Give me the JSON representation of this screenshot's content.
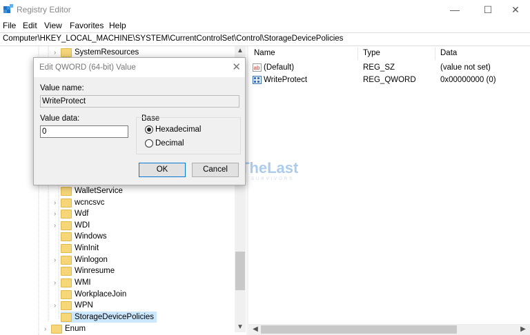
{
  "window": {
    "title": "Registry Editor",
    "controls": {
      "minimize": "—",
      "maximize": "☐",
      "close": "✕"
    }
  },
  "menu": [
    "File",
    "Edit",
    "View",
    "Favorites",
    "Help"
  ],
  "address": "Computer\\HKEY_LOCAL_MACHINE\\SYSTEM\\CurrentControlSet\\Control\\StorageDevicePolicies",
  "tree": {
    "items": [
      {
        "label": "SystemResources",
        "expandable": true
      },
      {
        "label": "WalletService",
        "expandable": false
      },
      {
        "label": "wcncsvc",
        "expandable": true
      },
      {
        "label": "Wdf",
        "expandable": true
      },
      {
        "label": "WDI",
        "expandable": true
      },
      {
        "label": "Windows",
        "expandable": false
      },
      {
        "label": "WinInit",
        "expandable": false
      },
      {
        "label": "Winlogon",
        "expandable": true
      },
      {
        "label": "Winresume",
        "expandable": false
      },
      {
        "label": "WMI",
        "expandable": true
      },
      {
        "label": "WorkplaceJoin",
        "expandable": false
      },
      {
        "label": "WPN",
        "expandable": true
      },
      {
        "label": "StorageDevicePolicies",
        "expandable": false,
        "selected": true
      },
      {
        "label": "Enum",
        "expandable": true
      }
    ]
  },
  "list": {
    "columns": [
      "Name",
      "Type",
      "Data"
    ],
    "rows": [
      {
        "name": "(Default)",
        "type": "REG_SZ",
        "data": "(value not set)",
        "icon": "string-value-icon"
      },
      {
        "name": "WriteProtect",
        "type": "REG_QWORD",
        "data": "0x00000000 (0)",
        "icon": "binary-value-icon"
      }
    ]
  },
  "dialog": {
    "title": "Edit QWORD (64-bit) Value",
    "value_name_label": "Value name:",
    "value_name": "WriteProtect",
    "value_data_label": "Value data:",
    "value_data": "0",
    "base_label": "Base",
    "base_options": [
      {
        "label": "Hexadecimal",
        "checked": true
      },
      {
        "label": "Decimal",
        "checked": false
      }
    ],
    "ok_label": "OK",
    "cancel_label": "Cancel"
  },
  "watermark": {
    "text": "TheLast",
    "subtext": "SURVIVORS"
  },
  "colors": {
    "folder": "#f5d679",
    "selection": "#cce8ff",
    "accent": "#0078d7"
  }
}
